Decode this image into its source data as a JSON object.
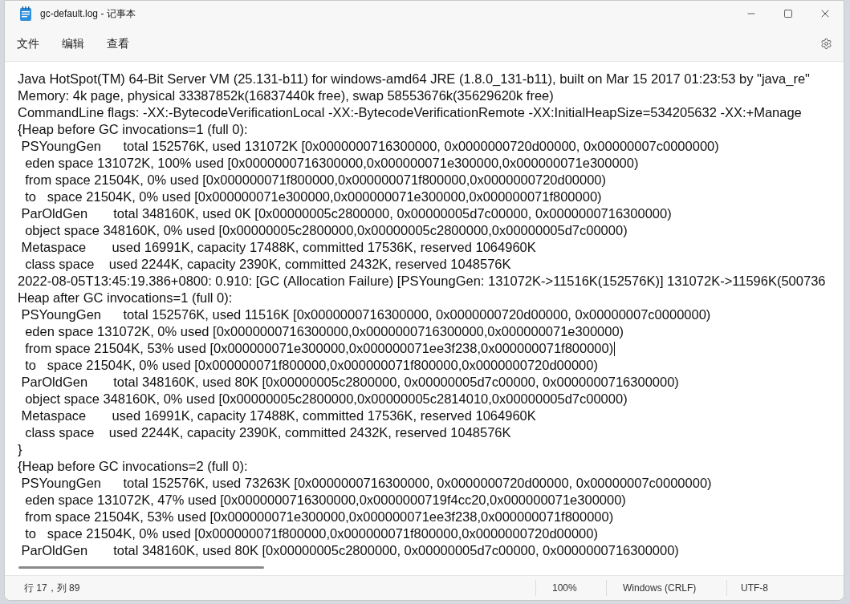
{
  "window": {
    "title": "gc-default.log - 记事本"
  },
  "menu": [
    "文件",
    "编辑",
    "查看"
  ],
  "editor": {
    "lines": [
      {
        "text": "Java HotSpot(TM) 64-Bit Server VM (25.131-b11) for windows-amd64 JRE (1.8.0_131-b11), built on Mar 15 2017 01:23:53 by \"java_re\"",
        "caret": false
      },
      {
        "text": "Memory: 4k page, physical 33387852k(16837440k free), swap 58553676k(35629620k free)",
        "caret": false
      },
      {
        "text": "CommandLine flags: -XX:-BytecodeVerificationLocal -XX:-BytecodeVerificationRemote -XX:InitialHeapSize=534205632 -XX:+Manage",
        "caret": false
      },
      {
        "text": "{Heap before GC invocations=1 (full 0):",
        "caret": false
      },
      {
        "text": " PSYoungGen      total 152576K, used 131072K [0x0000000716300000, 0x0000000720d00000, 0x00000007c0000000)",
        "caret": false
      },
      {
        "text": "  eden space 131072K, 100% used [0x0000000716300000,0x000000071e300000,0x000000071e300000)",
        "caret": false
      },
      {
        "text": "  from space 21504K, 0% used [0x000000071f800000,0x000000071f800000,0x0000000720d00000)",
        "caret": false
      },
      {
        "text": "  to   space 21504K, 0% used [0x000000071e300000,0x000000071e300000,0x000000071f800000)",
        "caret": false
      },
      {
        "text": " ParOldGen       total 348160K, used 0K [0x00000005c2800000, 0x00000005d7c00000, 0x0000000716300000)",
        "caret": false
      },
      {
        "text": "  object space 348160K, 0% used [0x00000005c2800000,0x00000005c2800000,0x00000005d7c00000)",
        "caret": false
      },
      {
        "text": " Metaspace       used 16991K, capacity 17488K, committed 17536K, reserved 1064960K",
        "caret": false
      },
      {
        "text": "  class space    used 2244K, capacity 2390K, committed 2432K, reserved 1048576K",
        "caret": false
      },
      {
        "text": "2022-08-05T13:45:19.386+0800: 0.910: [GC (Allocation Failure) [PSYoungGen: 131072K->11516K(152576K)] 131072K->11596K(500736",
        "caret": false
      },
      {
        "text": "Heap after GC invocations=1 (full 0):",
        "caret": false
      },
      {
        "text": " PSYoungGen      total 152576K, used 11516K [0x0000000716300000, 0x0000000720d00000, 0x00000007c0000000)",
        "caret": false
      },
      {
        "text": "  eden space 131072K, 0% used [0x0000000716300000,0x0000000716300000,0x000000071e300000)",
        "caret": false
      },
      {
        "text": "  from space 21504K, 53% used [0x000000071e300000,0x000000071ee3f238,0x000000071f800000)",
        "caret": true
      },
      {
        "text": "  to   space 21504K, 0% used [0x000000071f800000,0x000000071f800000,0x0000000720d00000)",
        "caret": false
      },
      {
        "text": " ParOldGen       total 348160K, used 80K [0x00000005c2800000, 0x00000005d7c00000, 0x0000000716300000)",
        "caret": false
      },
      {
        "text": "  object space 348160K, 0% used [0x00000005c2800000,0x00000005c2814010,0x00000005d7c00000)",
        "caret": false
      },
      {
        "text": " Metaspace       used 16991K, capacity 17488K, committed 17536K, reserved 1064960K",
        "caret": false
      },
      {
        "text": "  class space    used 2244K, capacity 2390K, committed 2432K, reserved 1048576K",
        "caret": false
      },
      {
        "text": "}",
        "caret": false
      },
      {
        "text": "{Heap before GC invocations=2 (full 0):",
        "caret": false
      },
      {
        "text": " PSYoungGen      total 152576K, used 73263K [0x0000000716300000, 0x0000000720d00000, 0x00000007c0000000)",
        "caret": false
      },
      {
        "text": "  eden space 131072K, 47% used [0x0000000716300000,0x0000000719f4cc20,0x000000071e300000)",
        "caret": false
      },
      {
        "text": "  from space 21504K, 53% used [0x000000071e300000,0x000000071ee3f238,0x000000071f800000)",
        "caret": false
      },
      {
        "text": "  to   space 21504K, 0% used [0x000000071f800000,0x000000071f800000,0x0000000720d00000)",
        "caret": false
      },
      {
        "text": " ParOldGen       total 348160K, used 80K [0x00000005c2800000, 0x00000005d7c00000, 0x0000000716300000)",
        "caret": false
      }
    ]
  },
  "status_bar": {
    "position": "行 17，列 89",
    "zoom": "100%",
    "line_ending": "Windows (CRLF)",
    "encoding": "UTF-8"
  }
}
